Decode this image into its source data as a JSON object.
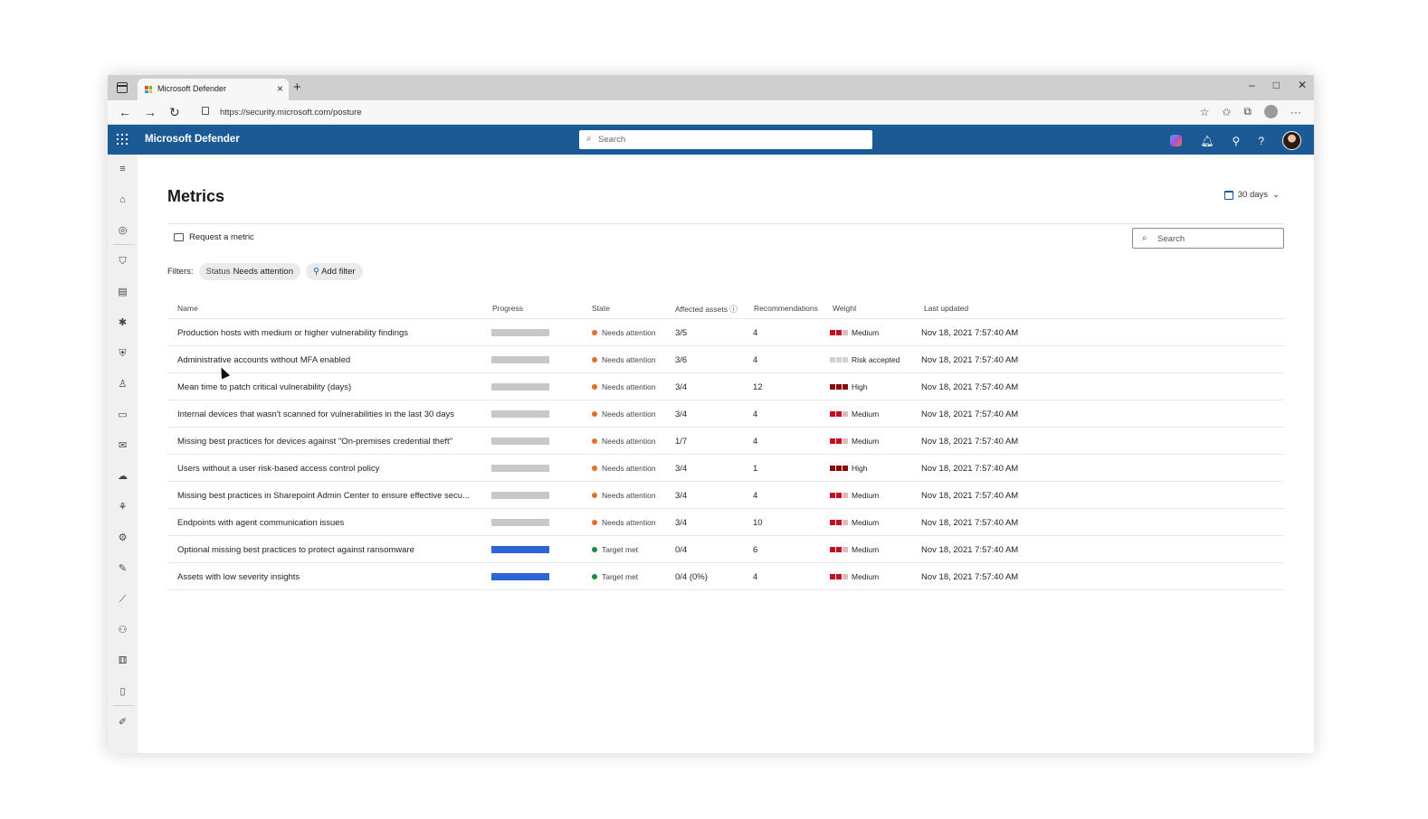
{
  "browser": {
    "tab_title": "Microsoft Defender",
    "tab_close": "×",
    "new_tab": "+",
    "url": "https://security.microsoft.com/posture",
    "window_controls": [
      "–",
      "□",
      "✕"
    ]
  },
  "header": {
    "app_name": "Microsoft Defender",
    "search_placeholder": "Search"
  },
  "page": {
    "title": "Metrics",
    "date_range": "30 days",
    "request_metric": "Request a metric",
    "search_placeholder": "Search",
    "filters_label": "Filters:",
    "status_filter_key": "Status",
    "status_filter_value": "Needs attention",
    "add_filter": "Add filter"
  },
  "colors": {
    "header_blue": "#1b5a94",
    "progress_gray": "#c8c8c8",
    "progress_blue": "#2c64d6",
    "needs_attention": "#e0702b",
    "target_met": "#1e8a3e",
    "weight_red": "#c50f1f",
    "weight_dark": "#8a0b0b",
    "weight_light": "#e2b8b8",
    "weight_gray": "#d2d2d2"
  },
  "table": {
    "columns": {
      "name": "Name",
      "progress": "Progress",
      "state": "State",
      "affected": "Affected assets",
      "recommendations": "Recommendations",
      "weight": "Weight",
      "updated": "Last updated"
    },
    "rows": [
      {
        "name": "Production hosts with medium or higher vulnerability findings",
        "progress": 0,
        "state": "Needs attention",
        "assets": "3/5",
        "recs": "4",
        "weight": "Medium",
        "weight_level": 2,
        "updated": "Nov 18, 2021 7:57:40 AM"
      },
      {
        "name": "Administrative accounts without MFA enabled",
        "progress": 0,
        "state": "Needs attention",
        "assets": "3/6",
        "recs": "4",
        "weight": "Risk accepted",
        "weight_level": 0,
        "updated": "Nov 18, 2021 7:57:40 AM"
      },
      {
        "name": "Mean time to patch critical vulnerability (days)",
        "progress": 0,
        "state": "Needs attention",
        "assets": "3/4",
        "recs": "12",
        "weight": "High",
        "weight_level": 3,
        "updated": "Nov 18, 2021 7:57:40 AM"
      },
      {
        "name": "Internal devices that wasn't scanned for vulnerabilities in the last 30 days",
        "progress": 0,
        "state": "Needs attention",
        "assets": "3/4",
        "recs": "4",
        "weight": "Medium",
        "weight_level": 2,
        "updated": "Nov 18, 2021 7:57:40 AM"
      },
      {
        "name": "Missing best practices for devices against \"On-premises credential theft\"",
        "progress": 0,
        "state": "Needs attention",
        "assets": "1/7",
        "recs": "4",
        "weight": "Medium",
        "weight_level": 2,
        "updated": "Nov 18, 2021 7:57:40 AM"
      },
      {
        "name": "Users without a user risk-based access control policy",
        "progress": 0,
        "state": "Needs attention",
        "assets": "3/4",
        "recs": "1",
        "weight": "High",
        "weight_level": 3,
        "updated": "Nov 18, 2021 7:57:40 AM"
      },
      {
        "name": "Missing best practices in Sharepoint Admin Center to ensure effective secu...",
        "progress": 0,
        "state": "Needs attention",
        "assets": "3/4",
        "recs": "4",
        "weight": "Medium",
        "weight_level": 2,
        "updated": "Nov 18, 2021 7:57:40 AM"
      },
      {
        "name": "Endpoints with agent communication issues",
        "progress": 0,
        "state": "Needs attention",
        "assets": "3/4",
        "recs": "10",
        "weight": "Medium",
        "weight_level": 2,
        "updated": "Nov 18, 2021 7:57:40 AM"
      },
      {
        "name": "Optional missing best practices to protect against ransomware",
        "progress": 100,
        "state": "Target met",
        "assets": "0/4",
        "recs": "6",
        "weight": "Medium",
        "weight_level": 2,
        "updated": "Nov 18, 2021 7:57:40 AM"
      },
      {
        "name": "Assets with low severity insights",
        "progress": 100,
        "state": "Target met",
        "assets": "0/4 (0%)",
        "recs": "4",
        "weight": "Medium",
        "weight_level": 2,
        "updated": "Nov 18, 2021 7:57:40 AM"
      }
    ]
  },
  "rail_icons": [
    "menu-icon",
    "home-icon",
    "radar-icon",
    "shield-icon",
    "report-icon",
    "bug-icon",
    "shield-check-icon",
    "user-icon",
    "device-icon",
    "mail-icon",
    "cloud-icon",
    "network-icon",
    "gear-icon",
    "wand-icon",
    "chart-icon",
    "identity-icon",
    "puzzle-icon",
    "book-icon",
    "edit-icon"
  ]
}
